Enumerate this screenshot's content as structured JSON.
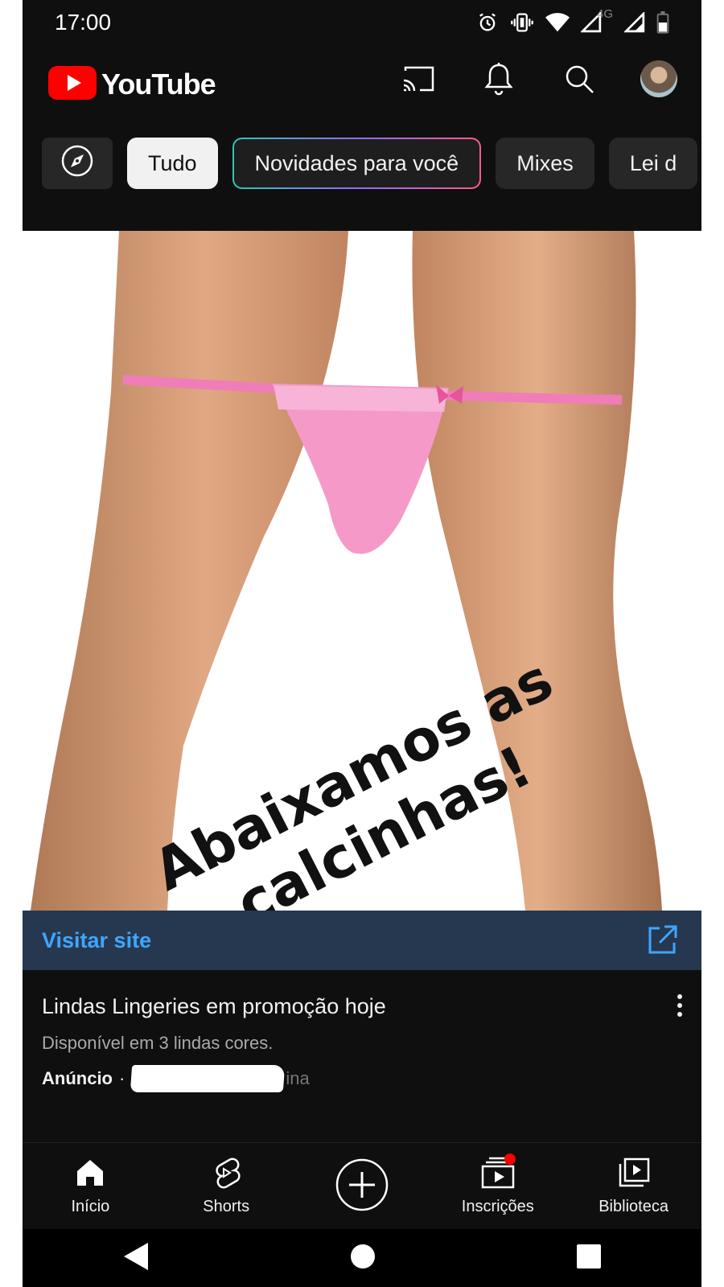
{
  "status_bar": {
    "time": "17:00",
    "network_label": "4G",
    "icons": [
      "alarm-icon",
      "vibrate-icon",
      "wifi-icon",
      "signal-icon",
      "signal-icon",
      "battery-icon"
    ]
  },
  "app_bar": {
    "logo_text": "YouTube",
    "brand_color": "#FF0000",
    "actions": [
      "cast-icon",
      "bell-icon",
      "search-icon",
      "avatar"
    ]
  },
  "chips": [
    {
      "label": "",
      "icon": "compass-icon"
    },
    {
      "label": "Tudo",
      "selected": true
    },
    {
      "label": "Novidades para você"
    },
    {
      "label": "Mixes"
    },
    {
      "label": "Lei d"
    }
  ],
  "ad": {
    "image_caption": "Abaixamos as calcinhas!",
    "visit_label": "Visitar site",
    "visit_icon": "external-link-icon",
    "title": "Lindas Lingeries em promoção hoje",
    "description": "Disponível em 3 lindas cores.",
    "badge": "Anúncio",
    "separator": "·",
    "advertiser_visible": "ina",
    "accent_color": "#3EA6FF"
  },
  "bottom_nav": [
    {
      "label": "Início",
      "icon": "home-icon"
    },
    {
      "label": "Shorts",
      "icon": "shorts-icon"
    },
    {
      "label": "",
      "icon": "create-icon"
    },
    {
      "label": "Inscrições",
      "icon": "subscriptions-icon"
    },
    {
      "label": "Biblioteca",
      "icon": "library-icon"
    }
  ],
  "system_nav": [
    "back-icon",
    "home-circle-icon",
    "recents-icon"
  ]
}
